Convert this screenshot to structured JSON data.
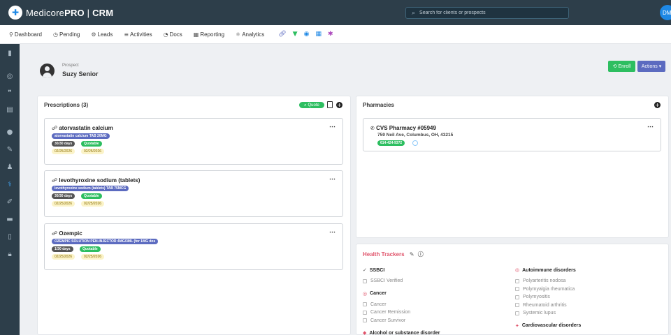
{
  "app": {
    "logo_name": "Medicore",
    "logo_pro": "PRO",
    "logo_crm": "CRM",
    "search_placeholder": "Search for clients or prospects",
    "user_initials": "DM"
  },
  "nav": [
    {
      "icon": "dashboard-icon",
      "glyph": "⚲",
      "label": "Dashboard"
    },
    {
      "icon": "pending-icon",
      "glyph": "◷",
      "label": "Pending"
    },
    {
      "icon": "leads-icon",
      "glyph": "⚙",
      "label": "Leads"
    },
    {
      "icon": "activities-icon",
      "glyph": "≡",
      "label": "Activities"
    },
    {
      "icon": "docs-icon",
      "glyph": "◔",
      "label": "Docs"
    },
    {
      "icon": "reporting-icon",
      "glyph": "▦",
      "label": "Reporting"
    },
    {
      "icon": "analytics-icon",
      "glyph": "⚛",
      "label": "Analytics"
    }
  ],
  "colors": {
    "topbar": "#2d3e4a",
    "green": "#2dbe60",
    "purple": "#5c6bc0",
    "accent_red": "#e0546b"
  },
  "prospect": {
    "label": "Prospect",
    "name": "Suzy Senior",
    "enroll_label": "Enroll",
    "actions_label": "Actions"
  },
  "prescriptions": {
    "title": "Prescriptions (3)",
    "quote_label": "Quote",
    "items": [
      {
        "name": "atorvastatin calcium",
        "drug_detail": "atorvastatin calcium TAB 20MG",
        "supply": "30/30 days",
        "status": "Quotable",
        "date_start": "02/25/2026",
        "date_end": "02/25/2026"
      },
      {
        "name": "levothyroxine sodium (tablets)",
        "drug_detail": "levothyroxine sodium (tablets) TAB 75MCG",
        "supply": "30/30 days",
        "status": "Quotable",
        "date_start": "02/25/2026",
        "date_end": "02/25/2026"
      },
      {
        "name": "Ozempic",
        "drug_detail": "OZEMPIC SOLUTION PEN-INJECTOR 4MG/3ML (for 1MG dos",
        "supply": "1/30 days",
        "status": "Quotable",
        "date_start": "02/25/2026",
        "date_end": "02/25/2026"
      }
    ]
  },
  "pharmacies": {
    "title": "Pharmacies",
    "items": [
      {
        "name": "CVS Pharmacy #05949",
        "address": "759 Neil Ave, Columbus, OH, 43215",
        "phone": "614-424-9372"
      }
    ]
  },
  "health_trackers": {
    "title": "Health Trackers",
    "left": [
      {
        "heading": "SSBCI",
        "glyph": "✓",
        "glyph_color": "#555",
        "items": [
          "SSBCI Verified"
        ]
      },
      {
        "heading": "Cancer",
        "glyph": "◎",
        "glyph_color": "#e0546b",
        "items": [
          "Cancer",
          "Cancer Remission",
          "Cancer Survivor"
        ]
      },
      {
        "heading": "Alcohol or substance disorder",
        "glyph": "◆",
        "glyph_color": "#e0546b",
        "items": []
      }
    ],
    "right": [
      {
        "heading": "Autoimmune disorders",
        "glyph": "◎",
        "glyph_color": "#e0546b",
        "items": [
          "Polyarteritis nodosa",
          "Polymyalgia rheumatica",
          "Polymyositis",
          "Rheumatoid arthritis",
          "Systemic lupus"
        ]
      },
      {
        "heading": "Cardiovascular disorders",
        "glyph": "✦",
        "glyph_color": "#e0546b",
        "items": []
      }
    ]
  }
}
